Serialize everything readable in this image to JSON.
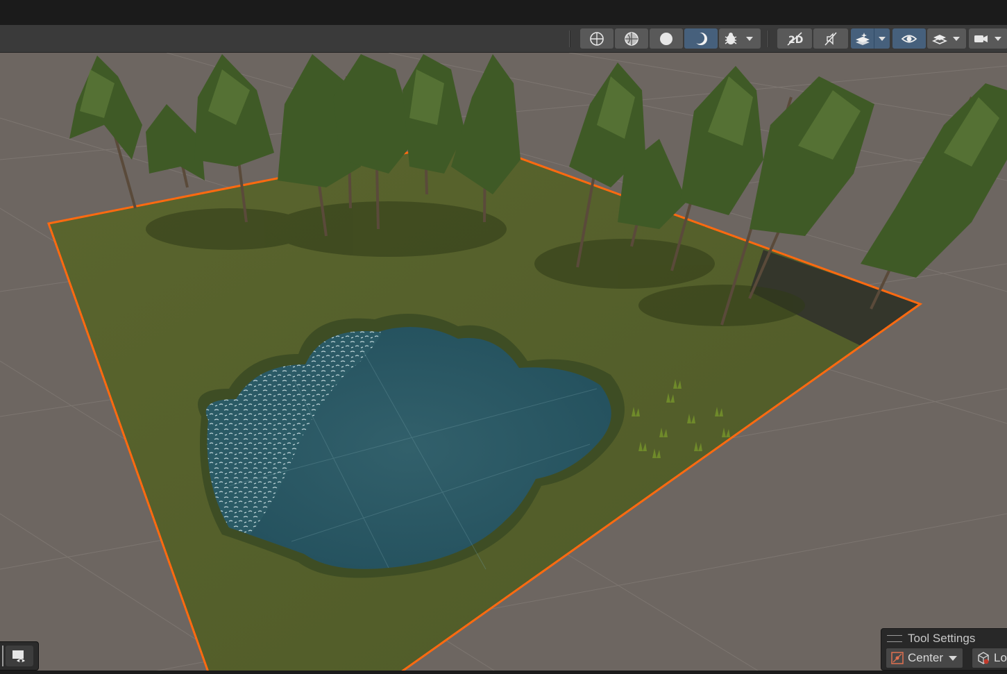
{
  "colors": {
    "ground": "#6d6661",
    "toolbar": "#3a3a3a",
    "button": "#595959",
    "button_active": "#46607c",
    "selection_outline": "#ff6a10",
    "grass": "#56612c",
    "water": "#2d5863"
  },
  "scene_toolbar": {
    "buttons": [
      {
        "name": "wireframe-shading-icon",
        "active": false
      },
      {
        "name": "shaded-wireframe-icon",
        "active": false
      },
      {
        "name": "shaded-sphere-icon",
        "active": false
      },
      {
        "name": "lit-moon-icon",
        "active": true
      },
      {
        "name": "debug-bug-icon",
        "active": false
      },
      {
        "name": "2d-toggle-icon",
        "active": false
      },
      {
        "name": "audio-mute-icon",
        "active": false
      },
      {
        "name": "effects-layers-icon",
        "active": true
      },
      {
        "name": "visibility-eye-icon",
        "active": true
      },
      {
        "name": "layers-icon",
        "active": false
      },
      {
        "name": "camera-icon",
        "active": false
      }
    ]
  },
  "tool_settings": {
    "title": "Tool Settings",
    "pivot_mode": "Center",
    "pivot_rotation": "Lo"
  },
  "overlay_menu": {
    "icon": "scene-view-camera-icon"
  }
}
